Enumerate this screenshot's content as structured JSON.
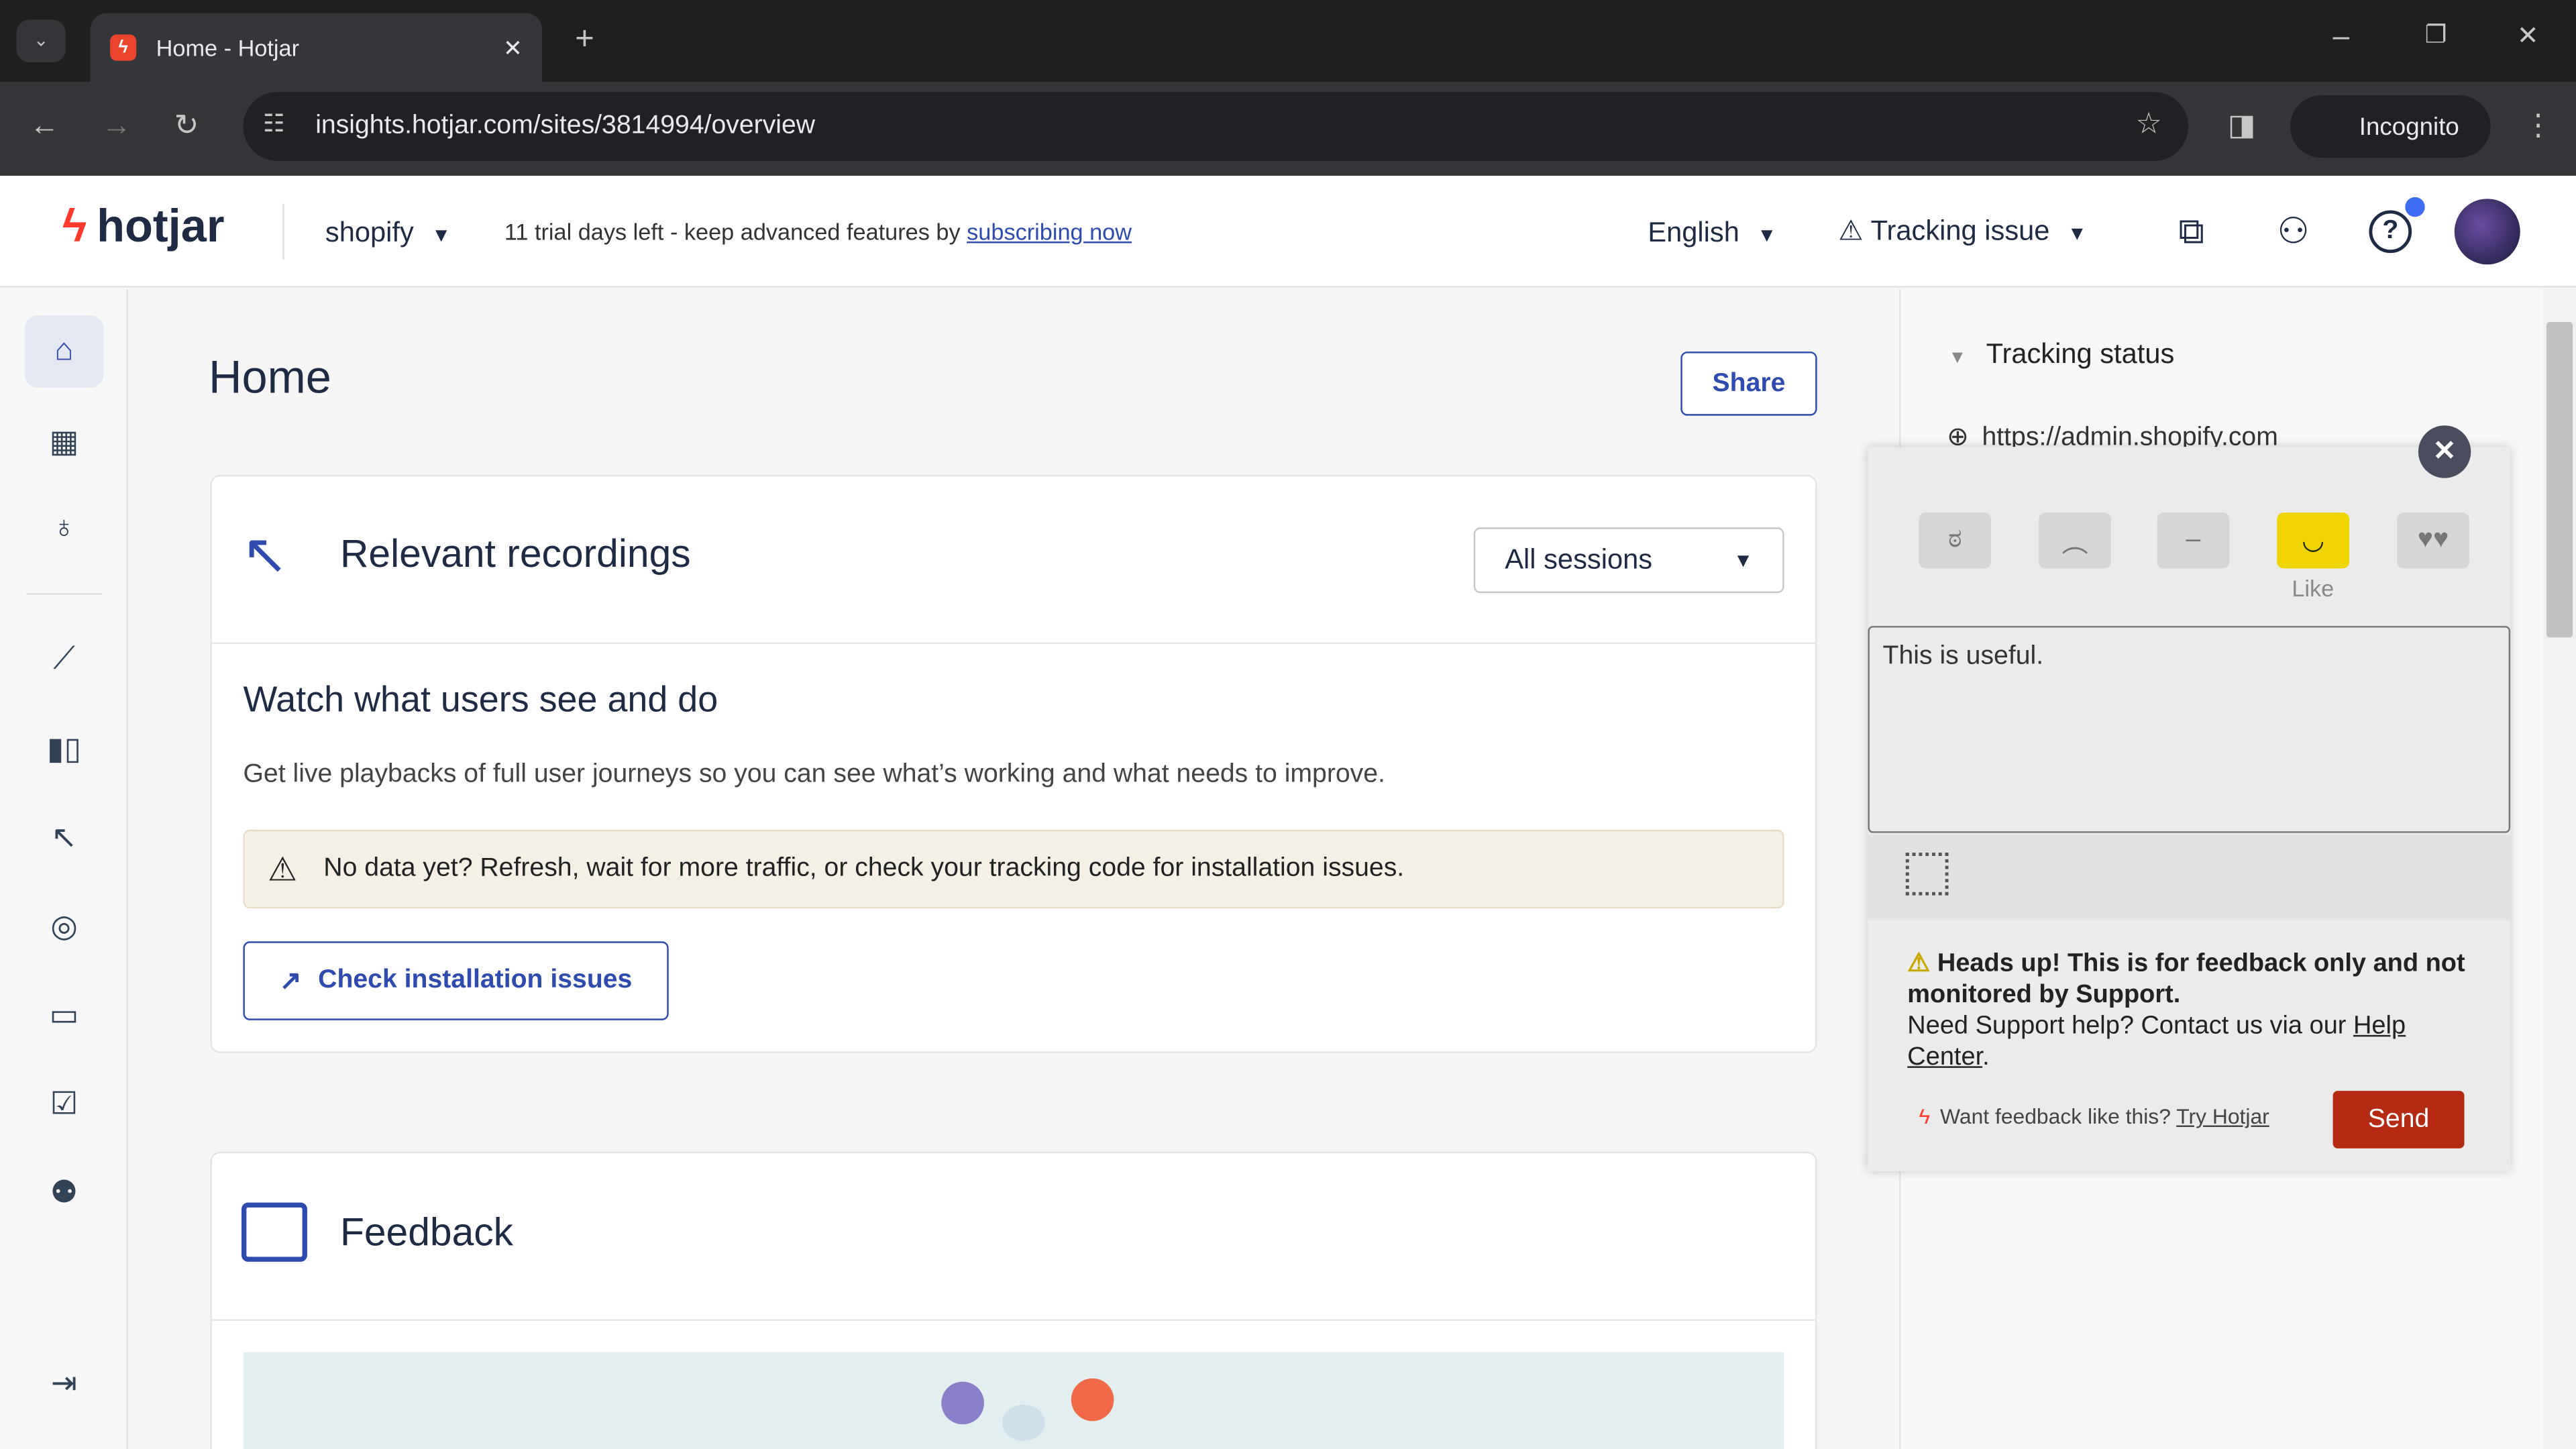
{
  "browser": {
    "tab_title": "Home - Hotjar",
    "url": "insights.hotjar.com/sites/3814994/overview",
    "incognito": "Incognito"
  },
  "header": {
    "logo": "hotjar",
    "site": "shopify",
    "trial_text": "11 trial days left - keep advanced features by ",
    "trial_link": "subscribing now",
    "language": "English",
    "tracking": "Tracking issue"
  },
  "sidebar": {
    "items": [
      "home",
      "dashboards",
      "highlights",
      "trends",
      "funnels",
      "recordings",
      "heatmaps",
      "feedback",
      "surveys",
      "interviews"
    ]
  },
  "main": {
    "title": "Home",
    "share": "Share",
    "recordings": {
      "title": "Relevant recordings",
      "filter": "All sessions",
      "heading": "Watch what users see and do",
      "desc": "Get live playbacks of full user journeys so you can see what’s working and what needs to improve.",
      "alert": "No data yet? Refresh, wait for more traffic, or check your tracking code for installation issues.",
      "check_btn": "Check installation issues"
    },
    "feedback": {
      "title": "Feedback"
    }
  },
  "right_panel": {
    "tracking_status": "Tracking status",
    "site_url": "https://admin.shopify.com"
  },
  "widget": {
    "selected_label": "Like",
    "selected_index": 3,
    "text": "This is useful.",
    "heads_up": "Heads up! This is for feedback only and not monitored by Support.",
    "support_text": "Need Support help? Contact us via our ",
    "help_link": "Help Center",
    "period": ".",
    "promo": "Want feedback like this? ",
    "promo_link": "Try Hotjar",
    "send": "Send"
  },
  "colors": {
    "accent": "#2e4bb0",
    "brand": "#fd3a2d",
    "send": "#b52a12",
    "like": "#f0d400"
  }
}
